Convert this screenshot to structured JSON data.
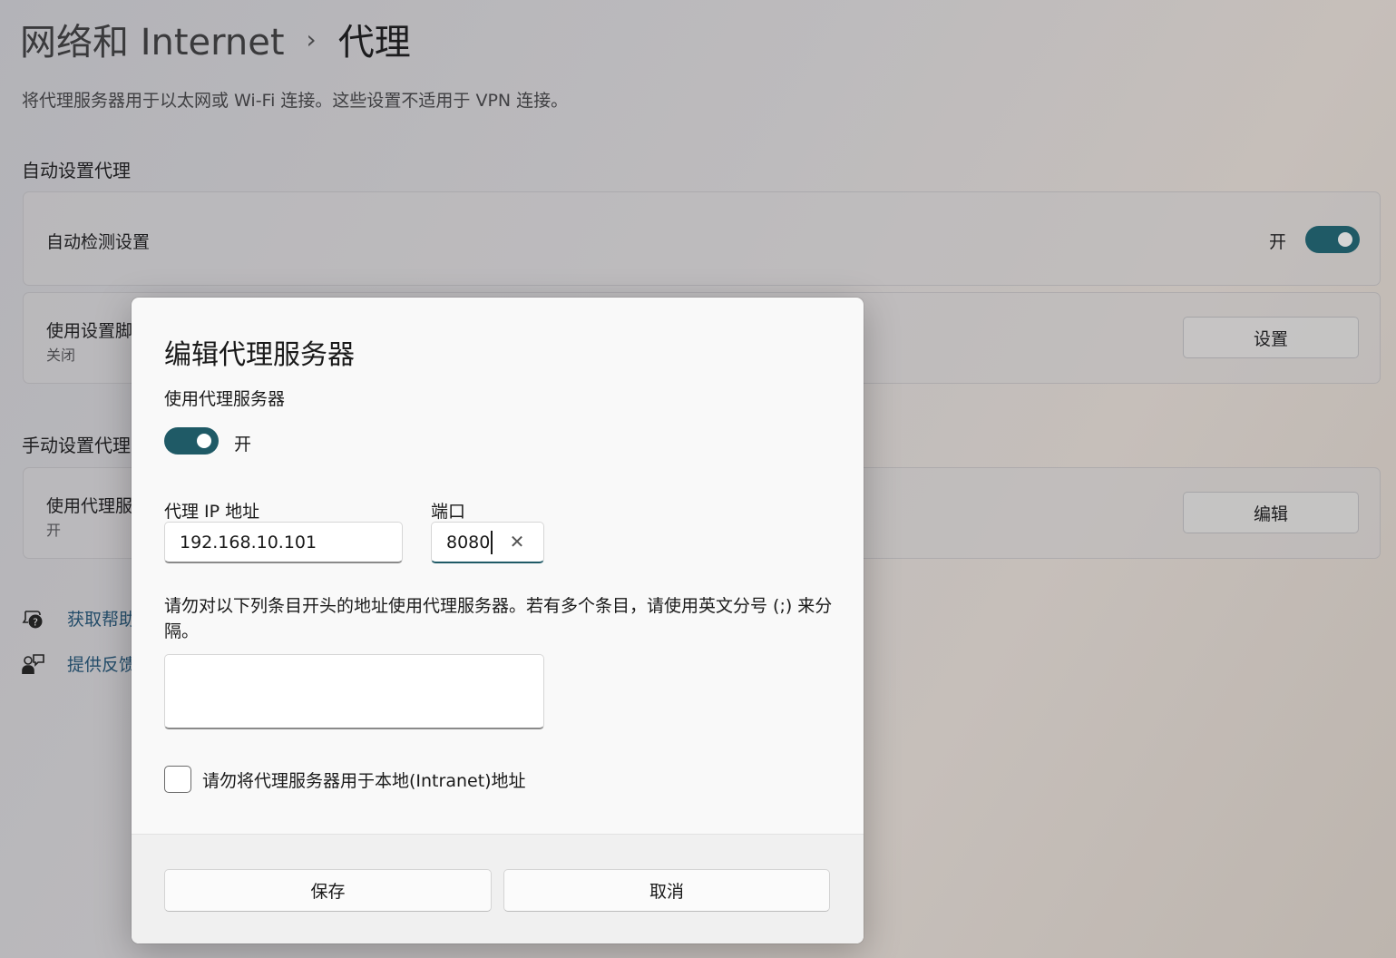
{
  "breadcrumb": {
    "parent": "网络和 Internet",
    "separator": "›",
    "current": "代理"
  },
  "description": "将代理服务器用于以太网或 Wi-Fi 连接。这些设置不适用于 VPN 连接。",
  "auto_section": {
    "title": "自动设置代理",
    "auto_detect": {
      "label": "自动检测设置",
      "state": "开",
      "on": true
    },
    "setup_script": {
      "label": "使用设置脚",
      "status": "关闭",
      "button": "设置"
    }
  },
  "manual_section": {
    "title": "手动设置代理",
    "use_proxy": {
      "label": "使用代理服",
      "status": "开",
      "button": "编辑"
    }
  },
  "links": {
    "help": "获取帮助",
    "feedback": "提供反馈"
  },
  "dialog": {
    "title": "编辑代理服务器",
    "use_proxy_label": "使用代理服务器",
    "toggle_state": "开",
    "toggle_on": true,
    "ip_label": "代理 IP 地址",
    "ip_value": "192.168.10.101",
    "port_label": "端口",
    "port_value": "8080",
    "exceptions_note": "请勿对以下列条目开头的地址使用代理服务器。若有多个条目，请使用英文分号 (;) 来分隔。",
    "exceptions_value": "",
    "local_checkbox_label": "请勿将代理服务器用于本地(Intranet)地址",
    "local_checked": false,
    "save_button": "保存",
    "cancel_button": "取消"
  },
  "colors": {
    "accent": "#1f5a66",
    "dialog_bg": "#f9f9f9",
    "footer_bg": "#f0f0f0",
    "link": "#244d6a"
  }
}
